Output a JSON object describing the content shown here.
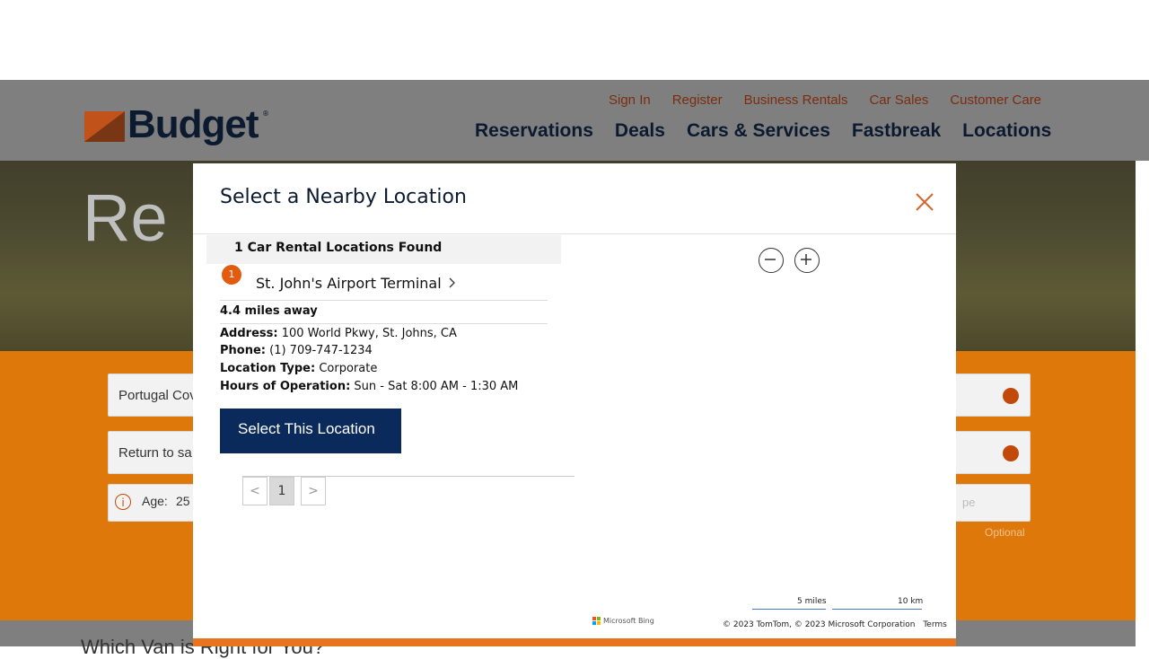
{
  "header": {
    "brand": "Budget",
    "brand_reg": "®",
    "util_nav": [
      "Sign In",
      "Register",
      "Business Rentals",
      "Car Sales",
      "Customer Care"
    ],
    "main_nav": [
      "Reservations",
      "Deals",
      "Cars & Services",
      "Fastbreak",
      "Locations"
    ]
  },
  "hero": {
    "title": "Re"
  },
  "form": {
    "pickup": "Portugal Cov",
    "return": "Return to sa",
    "age_label": "Age:",
    "age_value": "25",
    "type_placeholder": "pe",
    "optional": "Optional"
  },
  "below": {
    "heading": "Which Van is Right for You?"
  },
  "modal": {
    "title": "Select a Nearby Location",
    "found": "1 Car Rental Locations Found",
    "pin_number": "1",
    "location_name": "St. John's Airport Terminal",
    "distance": "4.4 miles away",
    "address_label": "Address:",
    "address": "100 World Pkwy, St. Johns, CA",
    "phone_label": "Phone:",
    "phone": "(1) 709-747-1234",
    "type_label": "Location Type:",
    "type": "Corporate",
    "hours_label": "Hours of Operation:",
    "hours": "Sun - Sat 8:00 AM - 1:30 AM",
    "select_button": "Select This Location",
    "pagination": {
      "prev": "<",
      "current": "1",
      "next": ">"
    }
  },
  "map": {
    "scale_miles": "5 miles",
    "scale_km": "10 km",
    "provider": "Microsoft Bing",
    "copyright": "© 2023 TomTom, © 2023 Microsoft Corporation",
    "terms": "Terms"
  },
  "colors": {
    "brand_navy": "#0c1a30",
    "brand_orange": "#ea7f0b",
    "button_navy": "#0b2a5c",
    "pin_orange": "#e35b0f"
  }
}
